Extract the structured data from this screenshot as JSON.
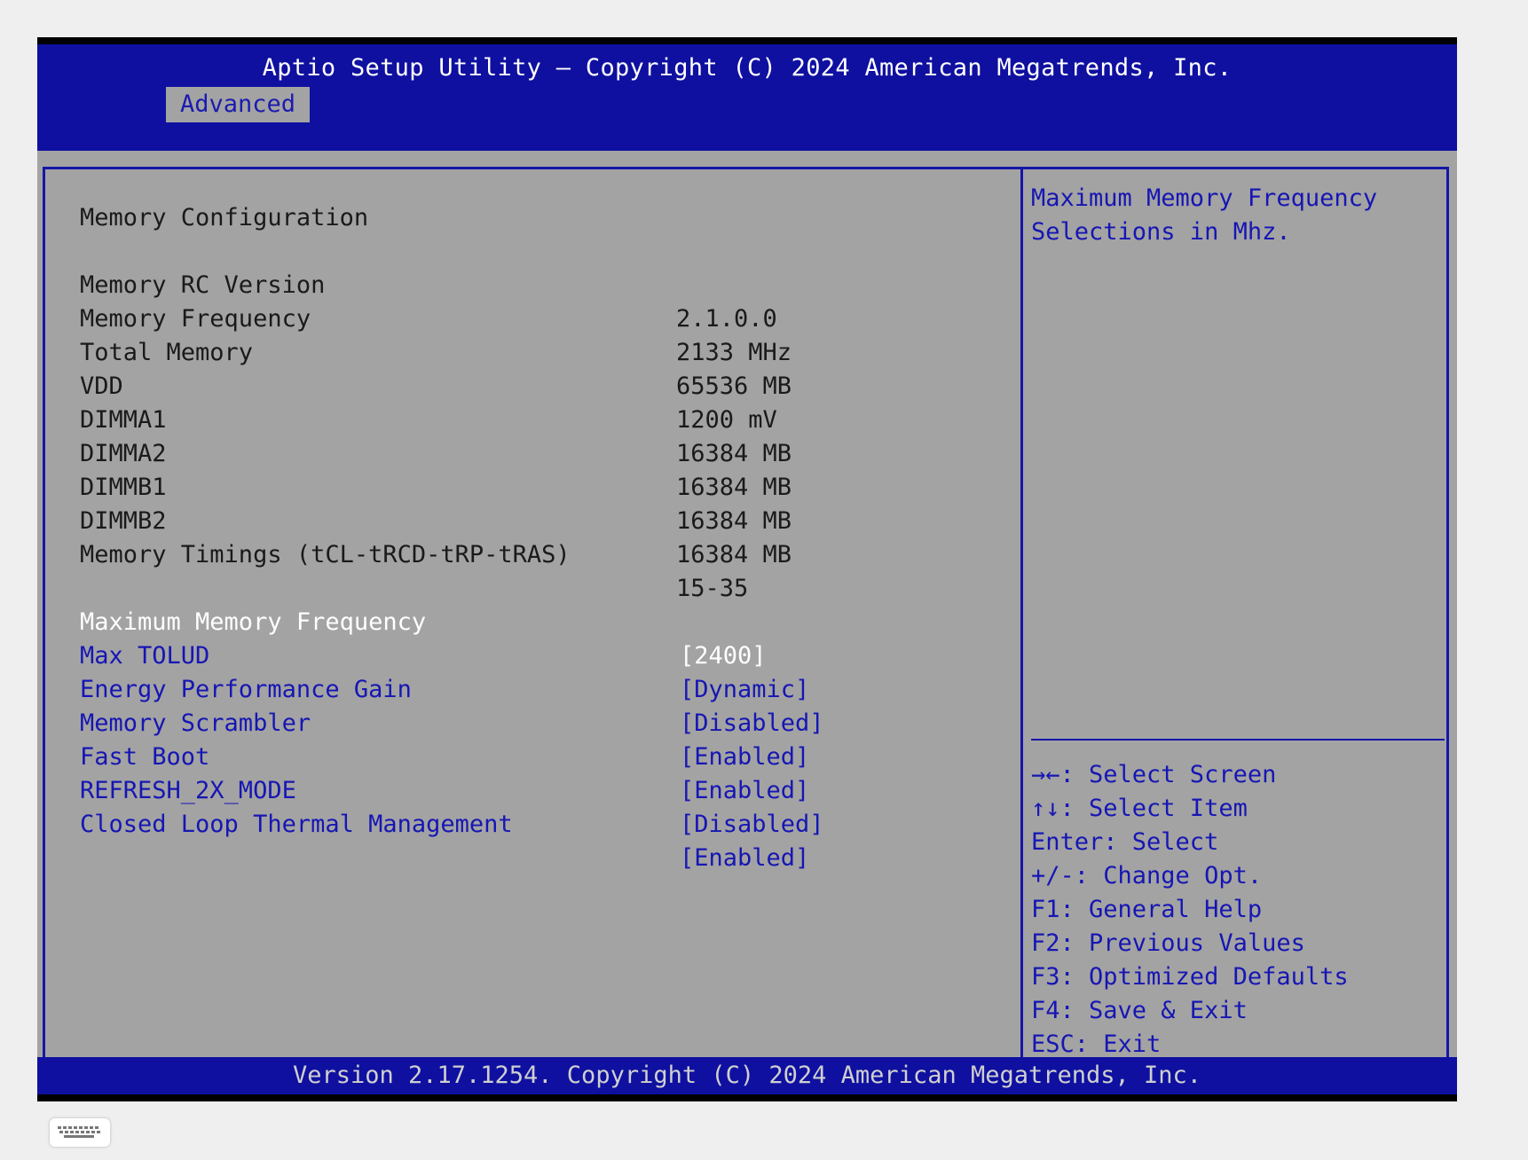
{
  "header": {
    "title": "Aptio Setup Utility – Copyright (C) 2024 American Megatrends, Inc.",
    "active_tab": "Advanced"
  },
  "section_title": "Memory Configuration",
  "info_rows": [
    {
      "label": "Memory RC Version",
      "value": "2.1.0.0"
    },
    {
      "label": "Memory Frequency",
      "value": "2133 MHz"
    },
    {
      "label": "Total Memory",
      "value": "65536 MB"
    },
    {
      "label": "VDD",
      "value": "1200 mV"
    },
    {
      "label": "DIMMA1",
      "value": "16384 MB"
    },
    {
      "label": "DIMMA2",
      "value": "16384 MB"
    },
    {
      "label": "DIMMB1",
      "value": "16384 MB"
    },
    {
      "label": "DIMMB2",
      "value": "16384 MB"
    },
    {
      "label": "Memory Timings (tCL-tRCD-tRP-tRAS)",
      "value": "15-35"
    }
  ],
  "options": [
    {
      "label": "Maximum Memory Frequency",
      "value": "[2400]",
      "selected": true
    },
    {
      "label": "Max TOLUD",
      "value": "[Dynamic]"
    },
    {
      "label": "Energy Performance Gain",
      "value": "[Disabled]"
    },
    {
      "label": "Memory Scrambler",
      "value": "[Enabled]"
    },
    {
      "label": "Fast Boot",
      "value": "[Enabled]"
    },
    {
      "label": "REFRESH_2X_MODE",
      "value": "[Disabled]"
    },
    {
      "label": "Closed Loop Thermal Management",
      "value": "[Enabled]"
    }
  ],
  "help_text": [
    "Maximum Memory Frequency",
    "Selections in Mhz."
  ],
  "key_help": [
    "→←: Select Screen",
    "↑↓: Select Item",
    "Enter: Select",
    "+/-: Change Opt.",
    "F1: General Help",
    "F2: Previous Values",
    "F3: Optimized Defaults",
    "F4: Save & Exit",
    "ESC: Exit"
  ],
  "footer": "Version 2.17.1254. Copyright (C) 2024 American Megatrends, Inc.",
  "keyboard_icon": "keyboard-icon",
  "colors": {
    "bios_blue": "#0f10a0",
    "panel_gray": "#a3a3a3",
    "option_blue": "#1616b4",
    "selected_white": "#ffffff"
  }
}
